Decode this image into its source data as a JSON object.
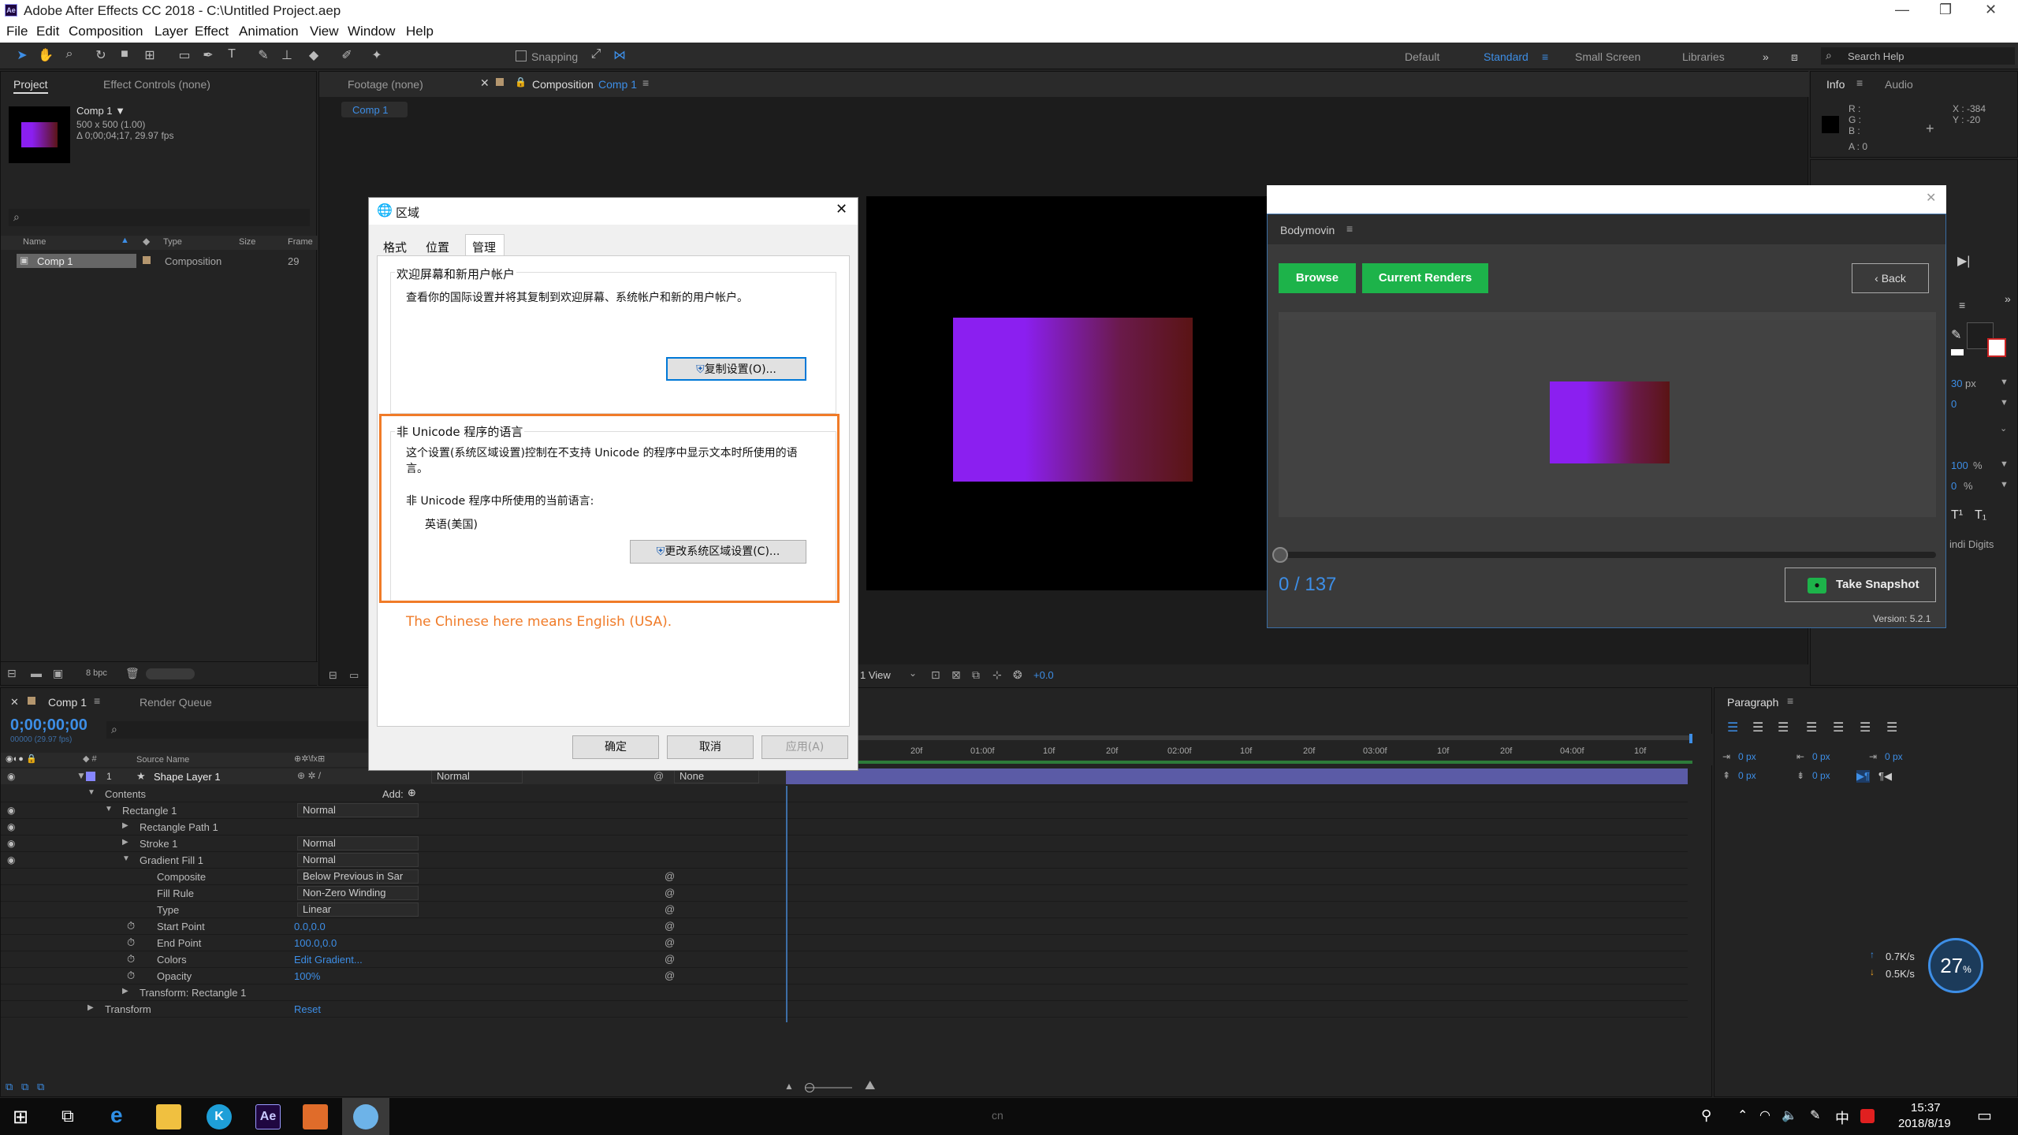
{
  "window": {
    "title": "Adobe After Effects CC 2018 - C:\\Untitled Project.aep",
    "app_icon": "Ae"
  },
  "menu": [
    "File",
    "Edit",
    "Composition",
    "Layer",
    "Effect",
    "Animation",
    "View",
    "Window",
    "Help"
  ],
  "toolbar": {
    "snapping": "Snapping",
    "workspaces": [
      "Default",
      "Standard",
      "Small Screen",
      "Libraries"
    ],
    "active_workspace": "Standard",
    "search_placeholder": "Search Help"
  },
  "project_panel": {
    "tabs": [
      "Project",
      "Effect Controls (none)"
    ],
    "comp_name": "Comp 1 ▼",
    "comp_size": "500 x 500 (1.00)",
    "comp_duration": "Δ 0;00;04;17, 29.97 fps",
    "columns": [
      "Name",
      "Type",
      "Size",
      "Frame"
    ],
    "items": [
      {
        "name": "Comp 1",
        "type": "Composition",
        "frame": "29"
      }
    ],
    "bpc": "8 bpc"
  },
  "viewer": {
    "tabs": [
      "Footage (none)",
      "Composition"
    ],
    "comp_tab_name": "Comp 1",
    "sub_tab": "Comp 1",
    "view_select": "1 View",
    "exposure": "+0.0"
  },
  "info_panel": {
    "tabs": [
      "Info",
      "Audio"
    ],
    "r": "R :",
    "g": "G :",
    "b": "B :",
    "a": "A : 0",
    "x": "X : -384",
    "y": "Y : -20"
  },
  "dialog": {
    "title": "区域",
    "tabs": [
      "格式",
      "位置",
      "管理"
    ],
    "active_tab": "管理",
    "section1_title": "欢迎屏幕和新用户帐户",
    "section1_text": "查看你的国际设置并将其复制到欢迎屏幕、系统帐户和新的用户帐户。",
    "copy_button": "复制设置(O)...",
    "section2_title": "非 Unicode 程序的语言",
    "section2_text": "这个设置(系统区域设置)控制在不支持 Unicode 的程序中显示文本时所使用的语言。",
    "current_lang_label": "非 Unicode 程序中所使用的当前语言:",
    "current_lang": "英语(美国)",
    "change_button": "更改系统区域设置(C)...",
    "annotation": "The Chinese here means English (USA).",
    "ok": "确定",
    "cancel": "取消",
    "apply": "应用(A)"
  },
  "bodymovin": {
    "title": "Bodymovin",
    "browse": "Browse",
    "current_renders": "Current Renders",
    "back": "‹ Back",
    "frames": "0 / 137",
    "snapshot": "Take Snapshot",
    "version": "Version: 5.2.1"
  },
  "right_side": {
    "size_px": "30",
    "size_unit": "px",
    "leading": "0",
    "scale_v": "100",
    "scale_h": "0",
    "pct": "%",
    "hindi": "indi Digits",
    "superscript": "T¹",
    "subscript": "T₁"
  },
  "timeline": {
    "tabs": [
      "Comp 1",
      "Render Queue"
    ],
    "timecode": "0;00;00;00",
    "fps": "00000 (29.97 fps)",
    "ruler": [
      "20f",
      "01:00f",
      "10f",
      "20f",
      "02:00f",
      "10f",
      "20f",
      "03:00f",
      "10f",
      "20f",
      "04:00f",
      "10f"
    ],
    "col_source": "Source Name",
    "layer": {
      "num": "1",
      "name": "Shape Layer 1",
      "mode": "Normal",
      "parent": "None"
    },
    "props": [
      {
        "name": "Contents",
        "indent": 1,
        "arrow": "▼",
        "value": "",
        "add": "Add:"
      },
      {
        "name": "Rectangle 1",
        "indent": 2,
        "arrow": "▼",
        "dd": "Normal",
        "eye": true
      },
      {
        "name": "Rectangle Path 1",
        "indent": 3,
        "arrow": "▶",
        "value": "",
        "eye": true
      },
      {
        "name": "Stroke 1",
        "indent": 3,
        "arrow": "▶",
        "dd": "Normal",
        "eye": true
      },
      {
        "name": "Gradient Fill 1",
        "indent": 3,
        "arrow": "▼",
        "dd": "Normal",
        "eye": true
      },
      {
        "name": "Composite",
        "indent": 4,
        "dd": "Below Previous in Sar"
      },
      {
        "name": "Fill Rule",
        "indent": 4,
        "dd": "Non-Zero Winding"
      },
      {
        "name": "Type",
        "indent": 4,
        "dd": "Linear"
      },
      {
        "name": "Start Point",
        "indent": 4,
        "stop": true,
        "value": "0.0,0.0"
      },
      {
        "name": "End Point",
        "indent": 4,
        "stop": true,
        "value": "100.0,0.0"
      },
      {
        "name": "Colors",
        "indent": 4,
        "stop": true,
        "value": "Edit Gradient..."
      },
      {
        "name": "Opacity",
        "indent": 4,
        "stop": true,
        "value": "100%"
      },
      {
        "name": "Transform: Rectangle 1",
        "indent": 3,
        "arrow": "▶",
        "value": ""
      },
      {
        "name": "Transform",
        "indent": 1,
        "arrow": "▶",
        "value": "Reset"
      }
    ]
  },
  "paragraph": {
    "title": "Paragraph",
    "px": "0 px"
  },
  "net": {
    "up": "0.7K/s",
    "down": "0.5K/s",
    "pct": "27"
  },
  "taskbar": {
    "time": "15:37",
    "date": "2018/8/19",
    "ime": "中",
    "watermark": "cn"
  },
  "colors": {
    "accent": "#3d8ee6",
    "annotation": "#f07b28",
    "green": "#1db34a",
    "purple": "#8b1ff0",
    "maroon": "#5a1414"
  }
}
